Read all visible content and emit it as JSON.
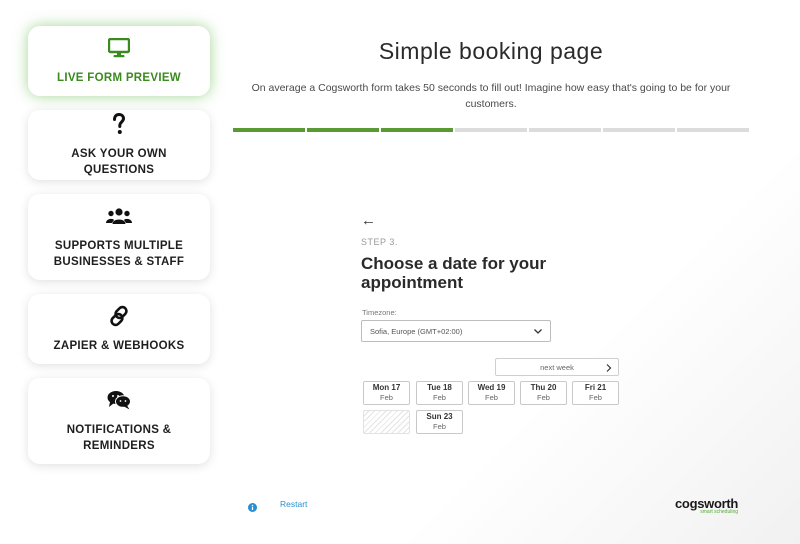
{
  "sidebar": {
    "items": [
      {
        "label": "LIVE FORM PREVIEW",
        "icon": "monitor-icon",
        "active": true
      },
      {
        "label": "ASK YOUR OWN QUESTIONS",
        "icon": "question-icon"
      },
      {
        "label": "SUPPORTS MULTIPLE BUSINESSES & STAFF",
        "icon": "users-icon"
      },
      {
        "label": "ZAPIER & WEBHOOKS",
        "icon": "link-icon"
      },
      {
        "label": "NOTIFICATIONS & REMINDERS",
        "icon": "chat-icon"
      }
    ]
  },
  "header": {
    "title": "Simple booking page",
    "subtitle": "On average a Cogsworth form takes 50 seconds to fill out! Imagine how easy that's going to be for your customers."
  },
  "progress": {
    "completed_steps": 3,
    "total_steps": 7
  },
  "form": {
    "back_arrow": "←",
    "step_label": "STEP 3.",
    "heading": "Choose a date for your appointment",
    "timezone_label": "Timezone:",
    "timezone_value": "Sofia, Europe (GMT+02:00)",
    "next_week_label": "next week",
    "days": [
      {
        "day": "Mon 17",
        "month": "Feb"
      },
      {
        "day": "Tue 18",
        "month": "Feb"
      },
      {
        "day": "Wed 19",
        "month": "Feb"
      },
      {
        "day": "Thu 20",
        "month": "Feb"
      },
      {
        "day": "Fri 21",
        "month": "Feb"
      },
      {
        "day": "Sun 23",
        "month": "Feb"
      }
    ]
  },
  "footer": {
    "restart_label": "Restart",
    "logo_text": "cogsworth",
    "logo_tagline": "smart scheduling"
  },
  "colors": {
    "accent_green": "#5a9a35",
    "link_blue": "#2a8fd0"
  }
}
